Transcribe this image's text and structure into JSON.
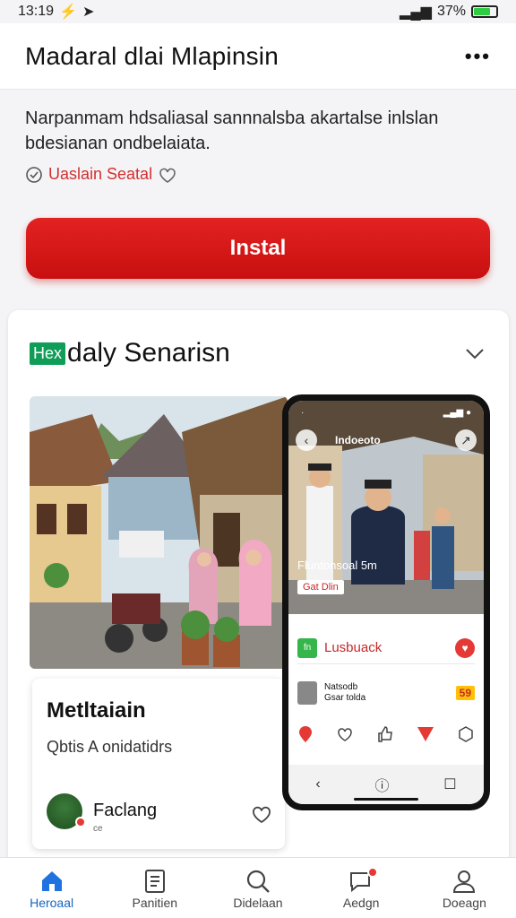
{
  "status": {
    "time": "13:19",
    "battery": "37%"
  },
  "header": {
    "title": "Madaral dlai Mlapinsin",
    "more_icon": "more-horizontal-icon"
  },
  "intro": {
    "line1": "Narpanmam hdsaliasal sannnalsba akartalse inlslan",
    "line2": "bdesianan ondbelaiata.",
    "badge_text": "Uaslain Seatal"
  },
  "install": {
    "label": "Instal"
  },
  "card": {
    "new_badge": "Hex",
    "title": "daly Senarisn",
    "info": {
      "title": "Metltaiain",
      "subtitle": "Qbtis A onidatidrs",
      "author": "Faclang",
      "author_sub": "ce"
    },
    "phone": {
      "brand": "Indoeoto",
      "caption": "Fluntonsoal 5m",
      "tag": "Gat Dlin",
      "row1_label": "Lusbuack",
      "row1_icon": "fn",
      "row2_line1": "Natsodb",
      "row2_line2": "Gsar tolda",
      "row2_badge": "59"
    }
  },
  "nav": {
    "items": [
      {
        "label": "Heroaal",
        "icon": "home-icon"
      },
      {
        "label": "Panitien",
        "icon": "document-icon"
      },
      {
        "label": "Didelaan",
        "icon": "search-icon"
      },
      {
        "label": "Aedgn",
        "icon": "chat-notification-icon"
      },
      {
        "label": "Doeagn",
        "icon": "profile-icon"
      }
    ]
  },
  "colors": {
    "accent_red": "#d81b1b",
    "nav_active": "#1565c0",
    "new_badge": "#0f9d58"
  }
}
